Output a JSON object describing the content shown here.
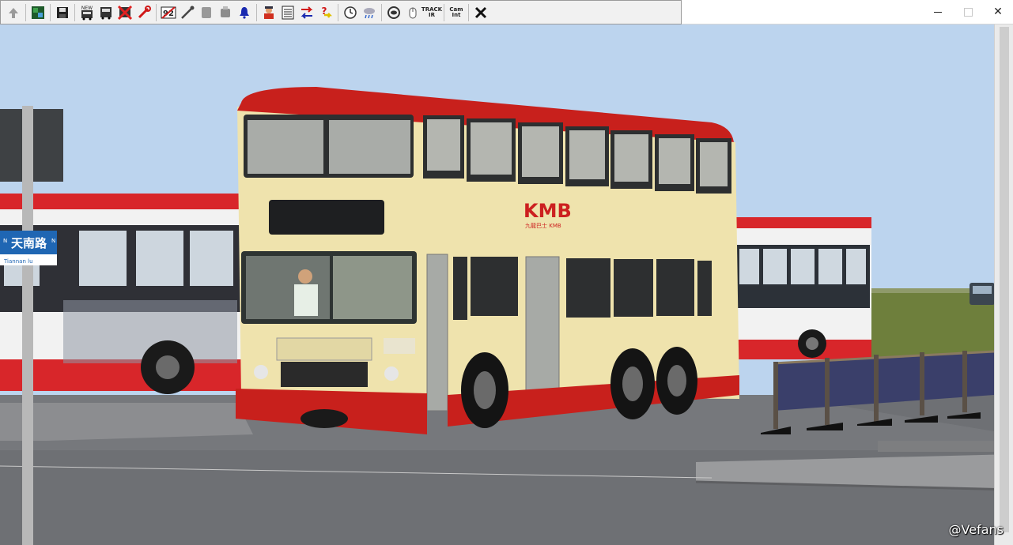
{
  "toolbar": {
    "buttons": [
      {
        "name": "up-arrow-icon"
      },
      {
        "name": "map-icon"
      },
      {
        "name": "save-icon"
      },
      {
        "name": "new-bus-icon",
        "label": "NEW"
      },
      {
        "name": "bus-icon"
      },
      {
        "name": "delete-bus-icon"
      },
      {
        "name": "wrench-red-icon"
      },
      {
        "name": "route-92-icon",
        "label": "92"
      },
      {
        "name": "tools-icon"
      },
      {
        "name": "ticket-icon"
      },
      {
        "name": "printer-icon"
      },
      {
        "name": "bell-icon"
      },
      {
        "name": "driver-icon"
      },
      {
        "name": "timetable-icon"
      },
      {
        "name": "exchange-icon"
      },
      {
        "name": "help-icon"
      },
      {
        "name": "clock-icon"
      },
      {
        "name": "weather-icon"
      },
      {
        "name": "camera-eye-icon"
      },
      {
        "name": "mouse-icon"
      },
      {
        "name": "trackir-icon",
        "label": "TRACK IR"
      },
      {
        "name": "cam-pos-icon",
        "label": "Cam Int"
      },
      {
        "name": "close-x-icon"
      }
    ]
  },
  "window": {
    "minimize": "–",
    "maximize": "□",
    "close": "✕"
  },
  "scene": {
    "bus_logo": "KMB",
    "bus_logo_sub": "九龍巴士 KMB",
    "stop_sign_text": "天南路",
    "stop_sign_sub": "Tiannan lu",
    "stop_sign_left": "N",
    "stop_sign_right": "N"
  },
  "watermark": "@Vefans",
  "colors": {
    "sky": "#bcd4ee",
    "road": "#6e7074",
    "bus_cream": "#efe3ad",
    "bus_red": "#c8201c",
    "city_bus_red": "#d8262a",
    "city_bus_white": "#f2f2f2",
    "grass": "#6e7f3c"
  }
}
